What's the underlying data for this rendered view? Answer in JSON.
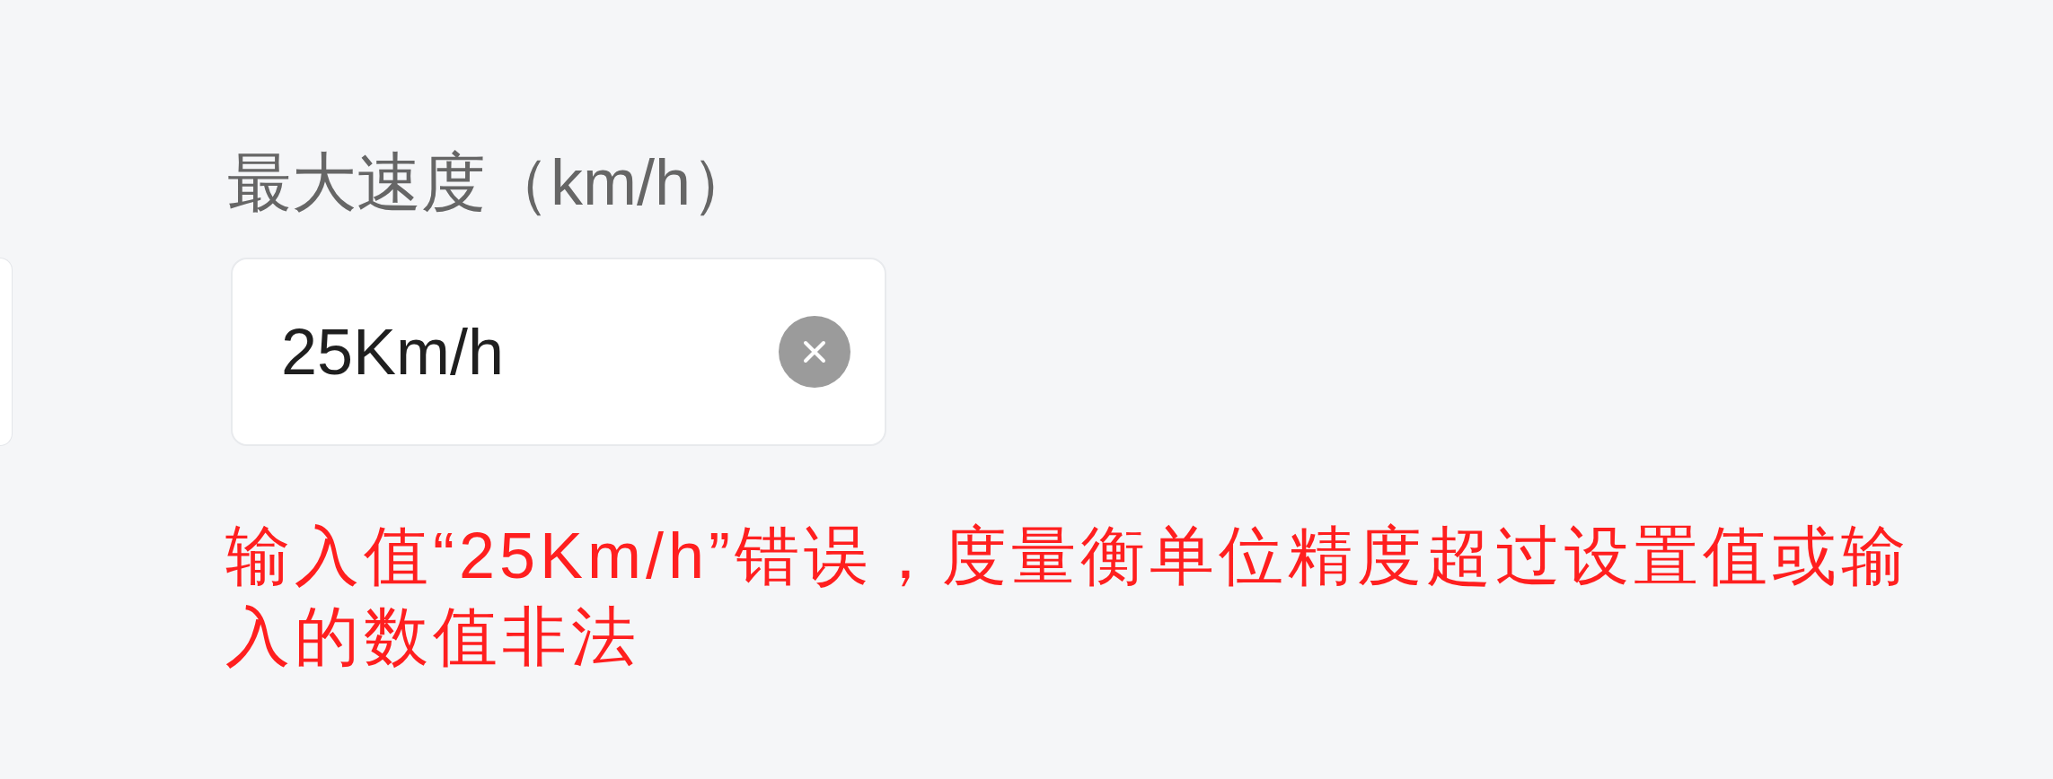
{
  "field": {
    "label": "最大速度（km/h）",
    "value": "25Km/h",
    "error": "输入值“25Km/h”错误，度量衡单位精度超过设置值或输入的数值非法"
  }
}
